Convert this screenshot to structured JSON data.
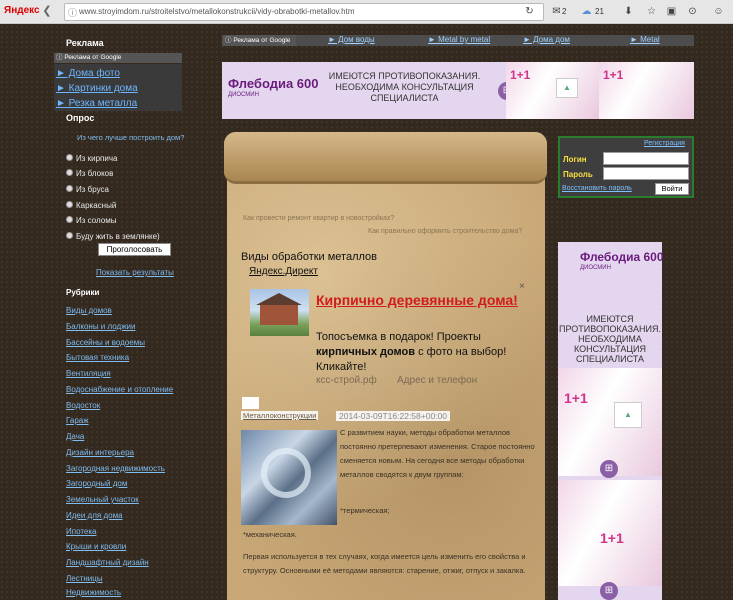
{
  "browser": {
    "brand": "Яндекс",
    "url": "www.stroyimdom.ru/stroitelstvo/metallokonstrukcii/vidy-obrabotki-metallov.htm",
    "mail_count": "2",
    "weather": "21"
  },
  "left": {
    "ads_heading": "Реклама",
    "google_ads_label": "Реклама от Google",
    "ad_links": [
      "► Дома фото",
      "► Картинки дома",
      "► Резка металла"
    ],
    "poll_heading": "Опрос",
    "poll_question": "Из чего лучше построить дом?",
    "poll_options": [
      "Из кирпича",
      "Из блоков",
      "Из бруса",
      "Каркасный",
      "Из соломы",
      "Буду жить в землянке)"
    ],
    "vote_button": "Проголосовать",
    "results_link": "Показать результаты",
    "rubrics_heading": "Рубрики",
    "rubrics": [
      "Виды домов",
      "Балконы и лоджии",
      "Бассейны и водоемы",
      "Бытовая техника",
      "Вентиляция",
      "Водоснабжение и отопление",
      "Водосток",
      "Гараж",
      "Дача",
      "Дизайн интерьера",
      "Загородная недвижимость",
      "Загородный дом",
      "Земельный участок",
      "Идеи для дома",
      "Ипотека",
      "Крыши и кровли",
      "Ландшафтный дизайн",
      "Лестницы",
      "Недвижимость"
    ]
  },
  "topnav": {
    "google_label": "Реклама от Google",
    "links": [
      "► Дом воды",
      "► Metal by metal",
      "► Дома дом",
      "► Metal"
    ]
  },
  "top_ad": {
    "brand": "Флебодиа 600",
    "brand_sub": "ДИОСМИН",
    "text": "ИМЕЮТСЯ ПРОТИВОПОКАЗАНИЯ. НЕОБХОДИМО ПРОКОНСУЛЬТИРОВАТЬСЯ СО СПЕЦИАЛИСТОМ",
    "text_lines": [
      "ИМЕЮТСЯ ПРОТИВОПОКАЗАНИЯ.",
      "НЕОБХОДИМА КОНСУЛЬТАЦИЯ",
      "СПЕЦИАЛИСТА"
    ],
    "promo": "1+1"
  },
  "login": {
    "register": "Регистрация",
    "login_label": "Логин",
    "password_label": "Пароль",
    "restore": "Восстановить пароль",
    "submit": "Войти"
  },
  "article": {
    "prev_link": "Как провести ремонт квартир в новостройках?",
    "next_link": "Как правильно оформить строительство дома?",
    "title": "Виды обработки металлов",
    "direct_label": "Яндекс.Директ",
    "ad_close": "×",
    "ad_title": "Кирпично деревянные дома!",
    "ad_body_1": "Топосъемка в подарок! Проекты ",
    "ad_body_bold": "кирпичных домов",
    "ad_body_2": " с фото на выбор! Кликайте!",
    "ad_domain": "ксс-строй.рф",
    "ad_contacts": "Адрес и телефон",
    "category": "Металлоконструкции",
    "date": "2014-03-09T16:22:58+00:00",
    "para1": "С развитием науки, методы обработки металлов постоянно претерпевают изменения. Старое постоянно сменяется новым. На сегодня все методы обработки металлов сводятся к двум группам:",
    "item1": "*термическая;",
    "item2": "*механическая.",
    "para2": "Первая используется в тех случаях, когда имеется цель изменить его свойства и структуру. Основными её методами являются: старение, отжиг, отпуск и закалка."
  },
  "right_ad": {
    "brand": "Флебодиа 600",
    "brand_sub": "ДИОСМИН",
    "text_lines": [
      "ИМЕЮТСЯ",
      "ПРОТИВОПОКАЗАНИЯ.",
      "НЕОБХОДИМА",
      "КОНСУЛЬТАЦИЯ",
      "СПЕЦИАЛИСТА"
    ],
    "promo": "1+1"
  }
}
